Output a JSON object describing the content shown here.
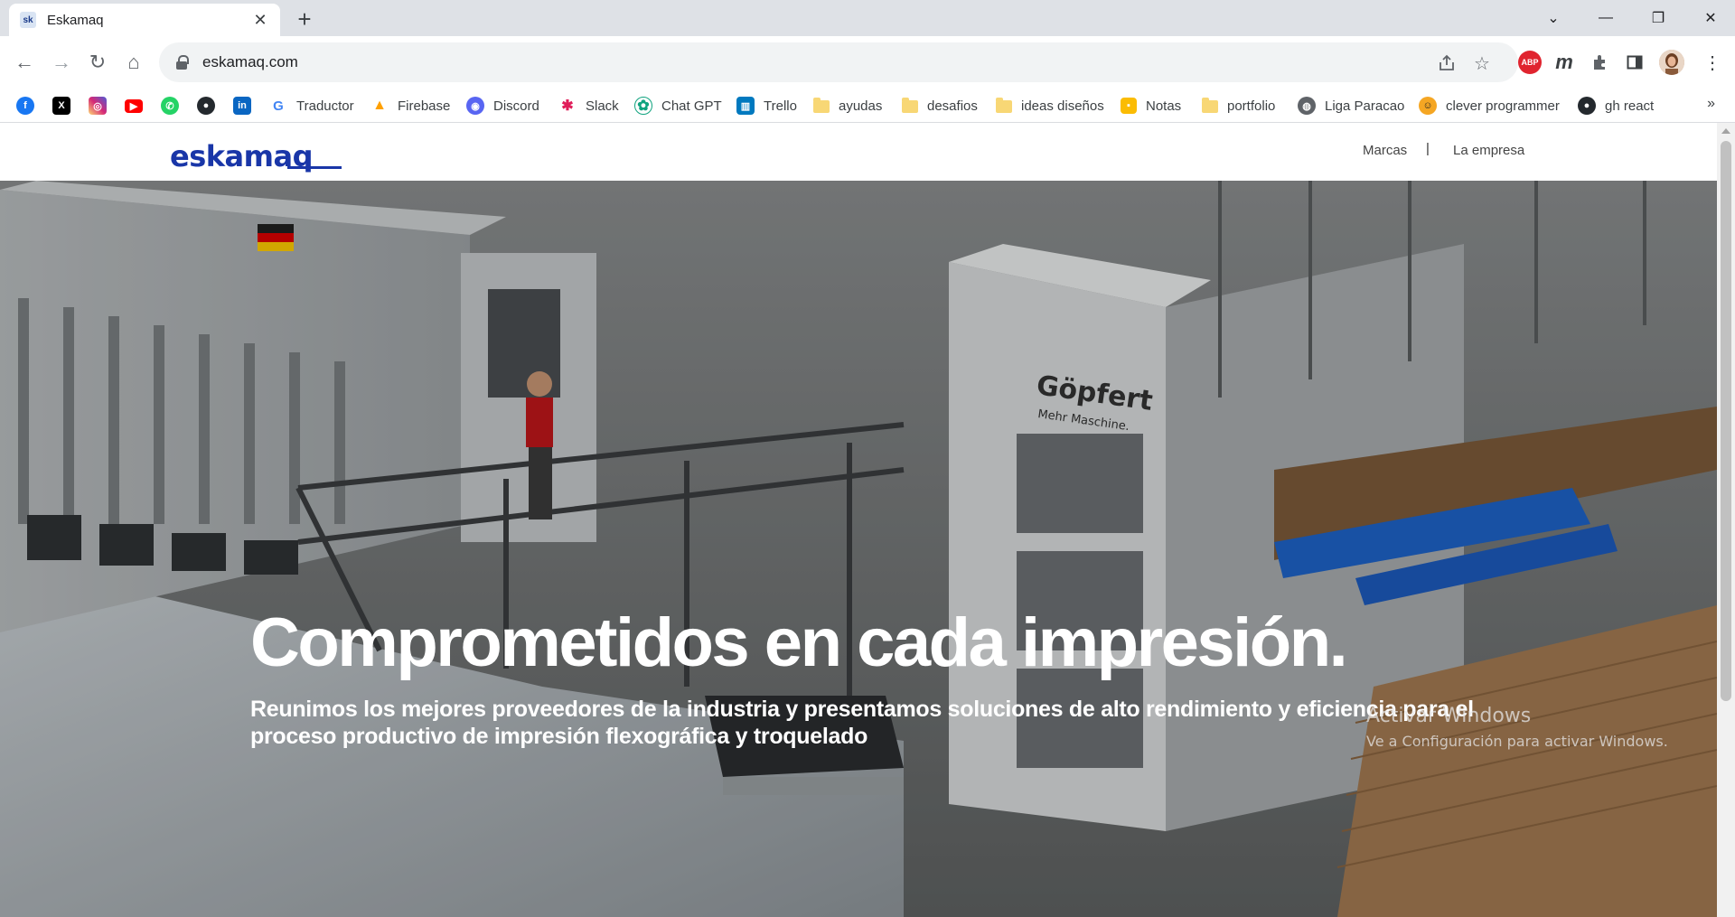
{
  "browser": {
    "tab": {
      "favicon_text": "sk",
      "title": "Eskamaq",
      "close": "✕"
    },
    "new_tab": "+",
    "window_controls": {
      "tab_search": "⌄",
      "minimize": "—",
      "restore": "❐",
      "close": "✕"
    },
    "nav": {
      "back": "←",
      "forward": "→",
      "reload": "↻",
      "home": "⌂"
    },
    "url": "eskamaq.com",
    "extensions": {
      "abp_label": "ABP",
      "m_label": "m"
    },
    "menu": "⋮",
    "bookmarks": [
      {
        "label": "",
        "icon": "facebook-icon",
        "color": "#1877f2"
      },
      {
        "label": "",
        "icon": "x-icon",
        "color": "#000000"
      },
      {
        "label": "",
        "icon": "instagram-icon",
        "color": "#d6249f"
      },
      {
        "label": "",
        "icon": "youtube-icon",
        "color": "#ff0000"
      },
      {
        "label": "",
        "icon": "whatsapp-icon",
        "color": "#25d366"
      },
      {
        "label": "",
        "icon": "github-icon",
        "color": "#24292e"
      },
      {
        "label": "",
        "icon": "linkedin-icon",
        "color": "#0a66c2"
      },
      {
        "label": "Traductor",
        "icon": "google-icon",
        "color": "#4285f4"
      },
      {
        "label": "Firebase",
        "icon": "firebase-icon",
        "color": "#ffa000"
      },
      {
        "label": "Discord",
        "icon": "discord-icon",
        "color": "#5865f2"
      },
      {
        "label": "Slack",
        "icon": "slack-icon",
        "color": "#4a154b"
      },
      {
        "label": "Chat GPT",
        "icon": "chatgpt-icon",
        "color": "#10a37f"
      },
      {
        "label": "Trello",
        "icon": "trello-icon",
        "color": "#0079bf"
      },
      {
        "label": "ayudas",
        "icon": "folder-icon",
        "color": "#f8d775"
      },
      {
        "label": "desafios",
        "icon": "folder-icon",
        "color": "#f8d775"
      },
      {
        "label": "ideas diseños",
        "icon": "folder-icon",
        "color": "#f8d775"
      },
      {
        "label": "Notas",
        "icon": "notes-icon",
        "color": "#fbbc04"
      },
      {
        "label": "portfolio",
        "icon": "folder-icon",
        "color": "#f8d775"
      },
      {
        "label": "Liga Paracao",
        "icon": "globe-icon",
        "color": "#5f6368"
      },
      {
        "label": "clever programmer",
        "icon": "clever-programmer-icon",
        "color": "#f5a623"
      },
      {
        "label": "gh react",
        "icon": "github-icon",
        "color": "#24292e"
      }
    ],
    "bookmarks_more": "»"
  },
  "site": {
    "logo": "eskamaq",
    "nav": {
      "brands": "Marcas",
      "separator": "|",
      "company": "La empresa"
    },
    "hero": {
      "title": "Comprometidos en cada impresión.",
      "subtitle": "Reunimos los mejores proveedores de la industria y presentamos soluciones de alto rendimiento y eficiencia para el proceso productivo de impresión flexográfica y troquelado",
      "machine_brand": "Göpfert",
      "machine_tagline": "Mehr Maschine."
    }
  },
  "os_watermark": {
    "line1": "Activar Windows",
    "line2": "Ve a Configuración para activar Windows."
  },
  "colors": {
    "brand": "#1936a8",
    "tabstrip": "#dee1e6",
    "omnibox": "#f1f3f4"
  }
}
